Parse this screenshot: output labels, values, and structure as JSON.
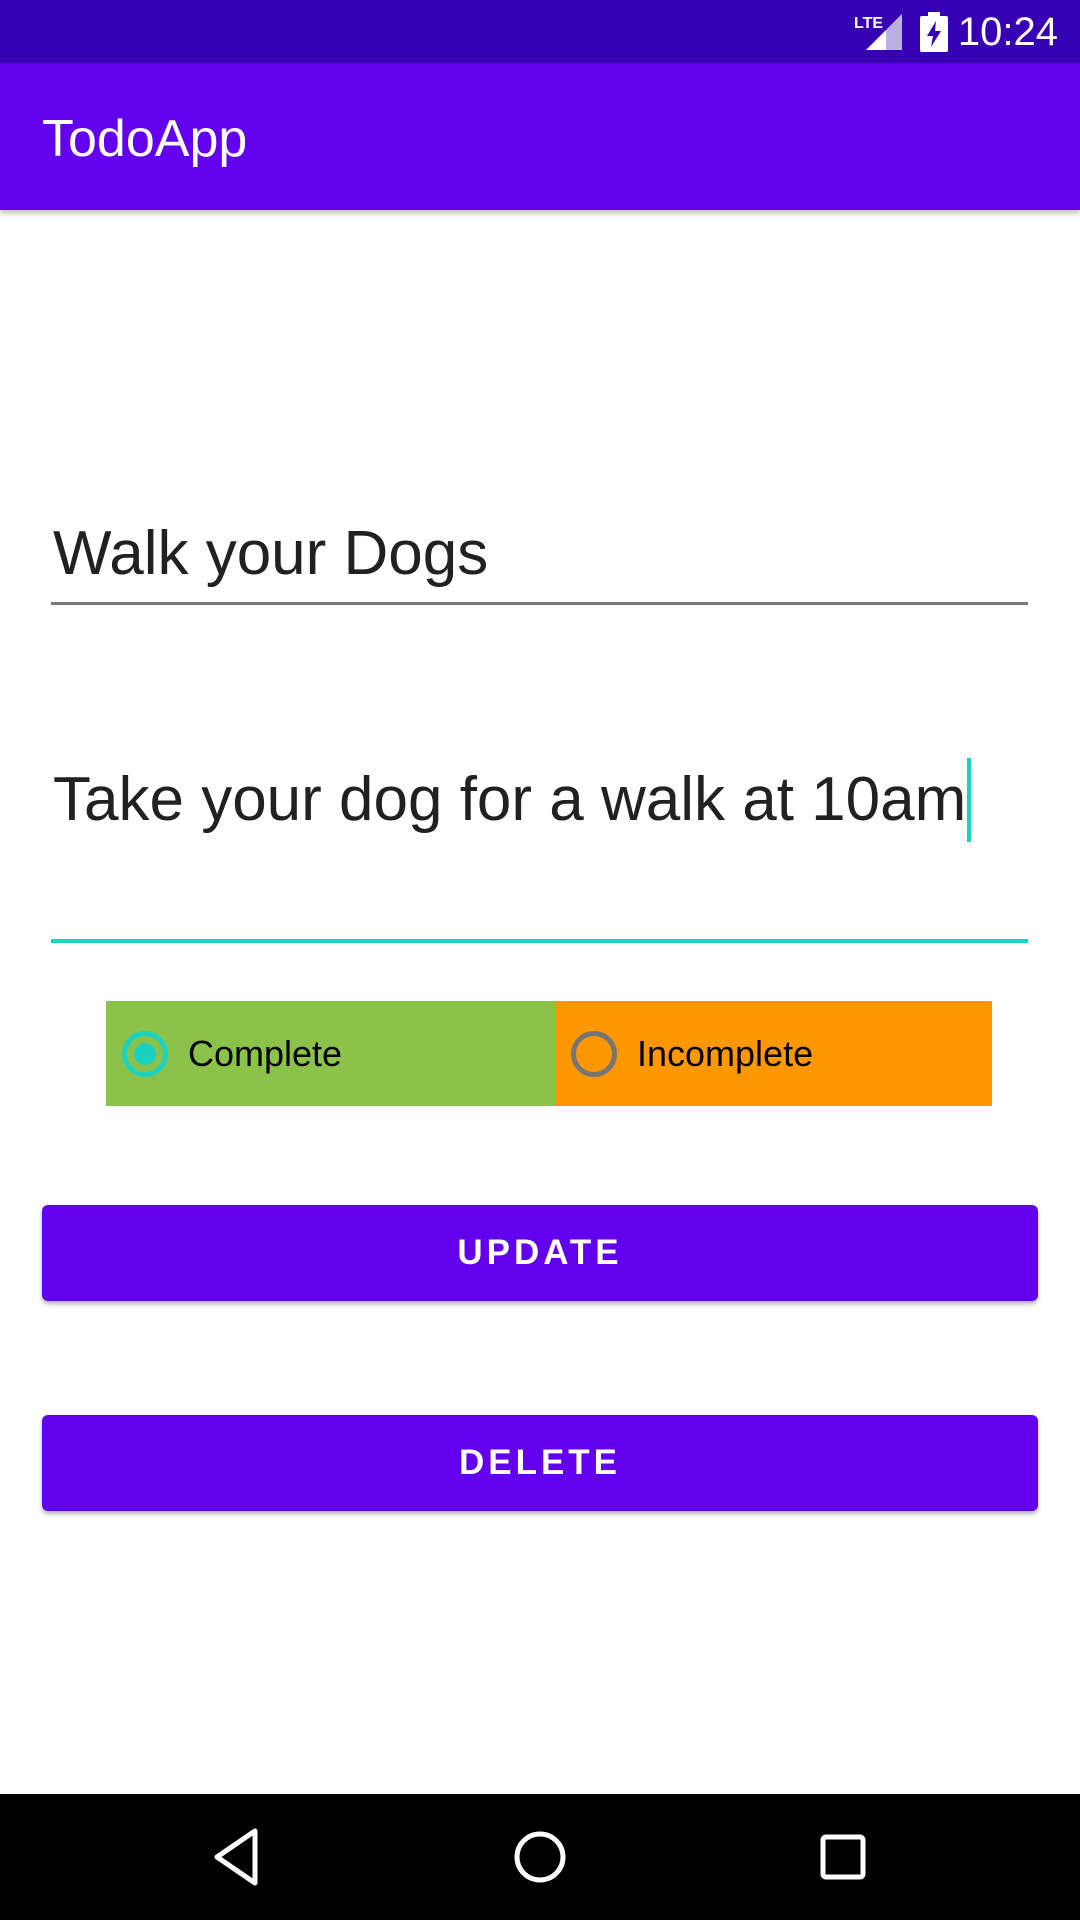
{
  "status_bar": {
    "time": "10:24",
    "network_label": "LTE",
    "icons": [
      "lte-signal-icon",
      "battery-charging-icon"
    ]
  },
  "app_bar": {
    "title": "TodoApp"
  },
  "form": {
    "title_value": "Walk your Dogs",
    "description_value": "Take your dog for a walk at 10am"
  },
  "status_options": [
    {
      "label": "Complete",
      "selected": true,
      "color": "#8bc34a"
    },
    {
      "label": "Incomplete",
      "selected": false,
      "color": "#ff9800"
    }
  ],
  "buttons": {
    "update_label": "UPDATE",
    "delete_label": "DELETE"
  },
  "nav_bar": {
    "icons": [
      "back-icon",
      "home-icon",
      "recents-icon"
    ]
  },
  "colors": {
    "status_bar": "#3700b3",
    "primary": "#6200ee",
    "accent": "#1dd1c1"
  }
}
